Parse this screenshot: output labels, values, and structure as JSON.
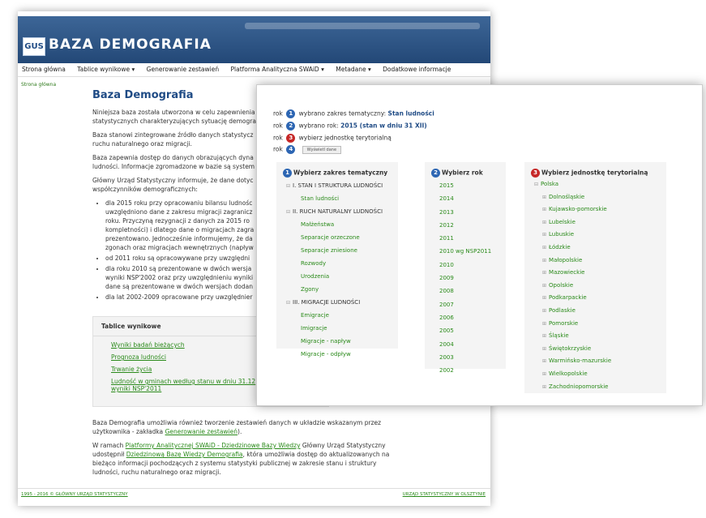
{
  "header": {
    "logo_text": "GUS",
    "title": "BAZA DEMOGRAFIA",
    "menu": [
      "Strona główna",
      "Tablice wynikowe ▾",
      "Generowanie zestawień",
      "Platforma Analityczna SWAiD ▾",
      "Metadane ▾",
      "Dodatkowe informacje"
    ]
  },
  "breadcrumb": "Strona główna",
  "page": {
    "title": "Baza Demografia",
    "p1": "Niniejsza baza została utworzona w celu zapewnienia",
    "p1b": "statystycznych charakteryzujących sytuację demogra",
    "p2": "Baza stanowi zintegrowane źródło danych statystycz",
    "p2b": "ruchu naturalnego oraz migracji.",
    "p3": "Baza zapewnia dostęp do danych obrazujących dyna",
    "p3b": "ludności. Informacje zgromadzone w bazie są system",
    "p4": "Główny Urząd Statystyczny informuje, że dane dotyc",
    "p4b": "współczynników demograficznych:",
    "bullets": [
      "dla 2015 roku przy opracowaniu bilansu ludnośc",
      "uwzględniono dane z zakresu migracji zagranicz",
      "roku. Przyczyną rezygnacji z danych za 2015 ro",
      "kompletności) i dlatego dane o migracjach zagra",
      "prezentowano. Jednocześnie informujemy, że da",
      "zgonach oraz migracjach wewnętrznych (napływ",
      "od 2011 roku są opracowywane przy uwzględni",
      "dla roku 2010 są prezentowane w dwóch wersja",
      "wyniki NSP'2002 oraz przy uwzględnieniu wyniki",
      "dane są prezentowane w dwóch wersjach dodan",
      "dla lat 2002-2009 opracowane przy uwzględnier"
    ]
  },
  "tablice": {
    "title": "Tablice wynikowe",
    "links": [
      "Wyniki badań bieżących",
      "Prognoza ludności",
      "Trwanie życia",
      "Ludność w gminach według stanu w dniu 31.12",
      "wyniki NSP'2011"
    ]
  },
  "bottom": {
    "p1a": "Baza Demografia umożliwia również tworzenie zestawień danych w układzie wskazanym przez",
    "p1b": "użytkownika - zakładka",
    "p1link": "Generowanie zestawień",
    "p2a": "W ramach",
    "p2link1": "Platformy Analitycznej SWAiD - Dziedzinowe Bazy Wiedzy",
    "p2b": "Główny Urząd Statystyczny",
    "p2c": "udostępnił",
    "p2link2": "Dziedzinową Bazę Wiedzy Demografia",
    "p2d": ", która umożliwia dostęp do aktualizowanych na",
    "p2e": "bieżąco informacji pochodzących z systemu statystyki publicznej w zakresie stanu i struktury",
    "p2f": "ludności, ruchu naturalnego oraz migracji."
  },
  "footer": {
    "left": "1995 - 2016 © GŁÓWNY URZĄD STATYSTYCZNY",
    "right": "URZĄD STATYSTYCZNY W OLSZTYNIE"
  },
  "wizard": {
    "steps": [
      {
        "prefix": "rok",
        "num": "1",
        "text": "wybrano zakres tematyczny:",
        "value": "Stan ludności"
      },
      {
        "prefix": "rok",
        "num": "2",
        "text": "wybrano rok:",
        "value": "2015 (stan w dniu 31 XII)"
      },
      {
        "prefix": "rok",
        "num": "3",
        "text": "wybierz jednostkę terytorialną",
        "value": ""
      },
      {
        "prefix": "rok",
        "num": "4",
        "text": "",
        "value": ""
      }
    ],
    "show_button": "Wyświetl dane",
    "col1": {
      "num": "1",
      "title": "Wybierz zakres tematyczny",
      "items": [
        {
          "label": "I. STAN I STRUKTURA LUDNOŚCI",
          "sec": true
        },
        {
          "label": "Stan ludności",
          "sec": false
        },
        {
          "label": "II. RUCH NATURALNY LUDNOŚCI",
          "sec": true
        },
        {
          "label": "Małżeństwa",
          "sec": false
        },
        {
          "label": "Separacje orzeczone",
          "sec": false
        },
        {
          "label": "Separacje zniesione",
          "sec": false
        },
        {
          "label": "Rozwody",
          "sec": false
        },
        {
          "label": "Urodzenia",
          "sec": false
        },
        {
          "label": "Zgony",
          "sec": false
        },
        {
          "label": "III. MIGRACJE LUDNOŚCI",
          "sec": true
        },
        {
          "label": "Emigracje",
          "sec": false
        },
        {
          "label": "Imigracje",
          "sec": false
        },
        {
          "label": "Migracje - napływ",
          "sec": false
        },
        {
          "label": "Migracje - odpływ",
          "sec": false
        }
      ]
    },
    "col2": {
      "num": "2",
      "title": "Wybierz rok",
      "items": [
        "2015",
        "2014",
        "2013",
        "2012",
        "2011",
        "2010 wg NSP2011",
        "2010",
        "2009",
        "2008",
        "2007",
        "2006",
        "2005",
        "2004",
        "2003",
        "2002"
      ]
    },
    "col3": {
      "num": "3",
      "title": "Wybierz jednostkę terytorialną",
      "items": [
        "Polska",
        "Dolnośląskie",
        "Kujawsko-pomorskie",
        "Lubelskie",
        "Lubuskie",
        "Łódzkie",
        "Małopolskie",
        "Mazowieckie",
        "Opolskie",
        "Podkarpackie",
        "Podlaskie",
        "Pomorskie",
        "Śląskie",
        "Świętokrzyskie",
        "Warmińsko-mazurskie",
        "Wielkopolskie",
        "Zachodniopomorskie"
      ]
    }
  }
}
